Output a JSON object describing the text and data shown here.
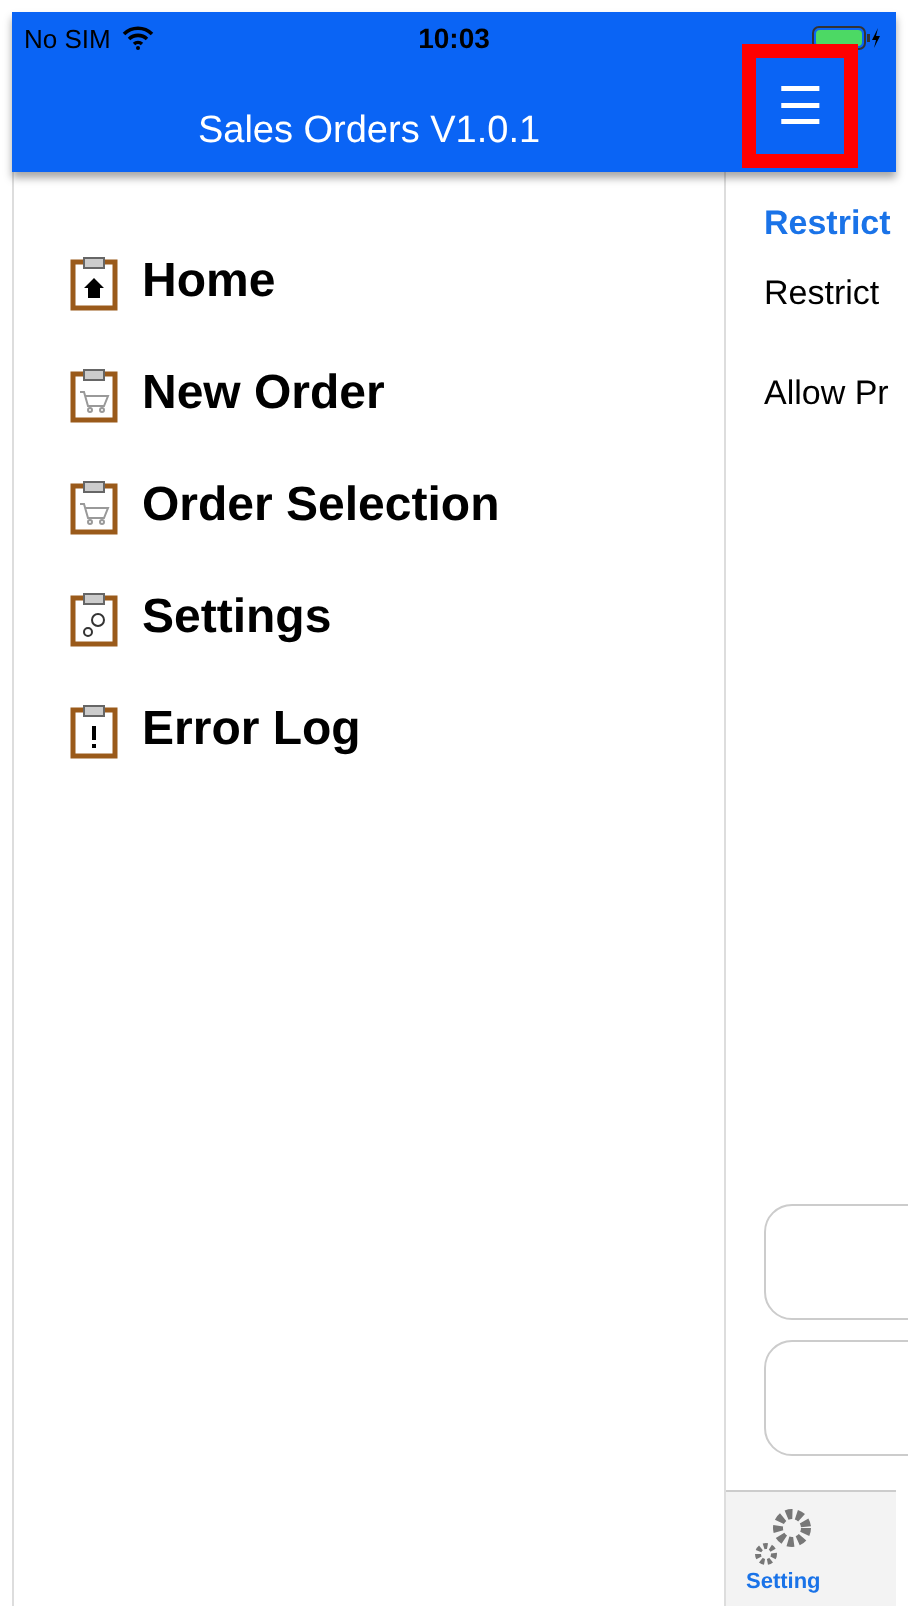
{
  "status_bar": {
    "carrier": "No SIM",
    "time": "10:03",
    "battery": {
      "level": 1
    }
  },
  "nav_bar": {
    "title": "Sales Orders V1.0.1",
    "menu_button": "☰",
    "highlighted": true
  },
  "menu": {
    "items": [
      {
        "label": "Home",
        "kind": "home"
      },
      {
        "label": "New Order",
        "kind": "cart"
      },
      {
        "label": "Order Selection",
        "kind": "cart"
      },
      {
        "label": "Settings",
        "kind": "gear"
      },
      {
        "label": "Error Log",
        "kind": "alert"
      }
    ]
  },
  "detail": {
    "section_header": "Restrict",
    "rows": [
      "Restrict",
      "Allow Pr"
    ],
    "buttons": [
      {
        "kind": "blank"
      },
      {
        "kind": "blank"
      }
    ]
  },
  "tab_bar": {
    "items": [
      {
        "label": "Setting",
        "selected": true
      }
    ]
  }
}
